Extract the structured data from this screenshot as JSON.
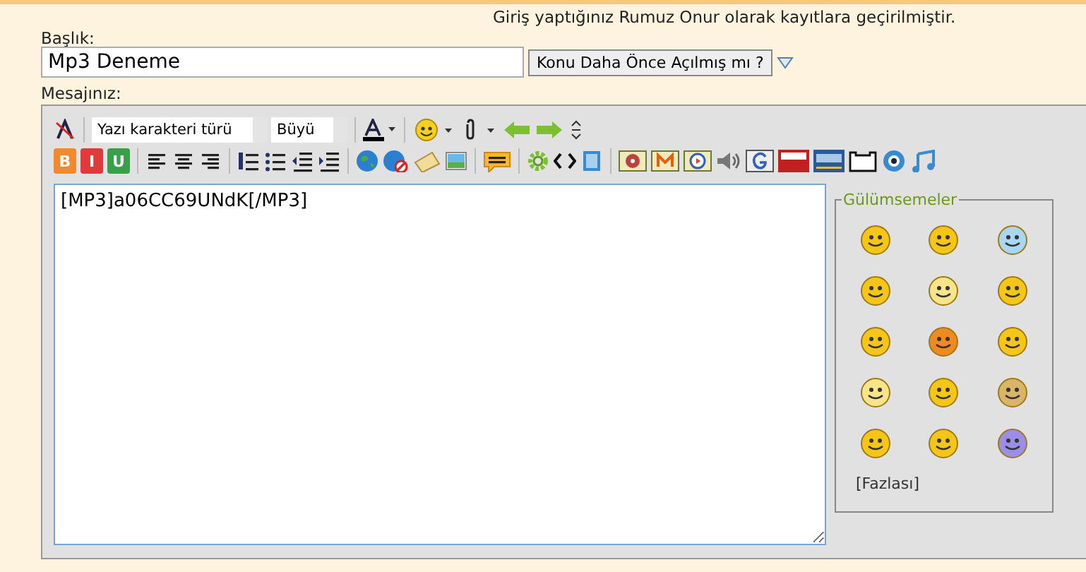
{
  "notice": "Giriş yaptığınız Rumuz Onur olarak kayıtlara geçirilmiştir.",
  "title_label": "Başlık:",
  "title_value": "Mp3 Deneme",
  "check_button": "Konu Daha Önce Açılmış mı ?",
  "message_label": "Mesajınız:",
  "font_select": "Yazı karakteri türü",
  "size_select": "Büyü",
  "format_buttons": [
    "B",
    "I",
    "U"
  ],
  "message_value": "[MP3]a06CC69UNdK[/MP3]",
  "smilies_title": "Gülümsemeler",
  "more_link": "[Fazlası]"
}
